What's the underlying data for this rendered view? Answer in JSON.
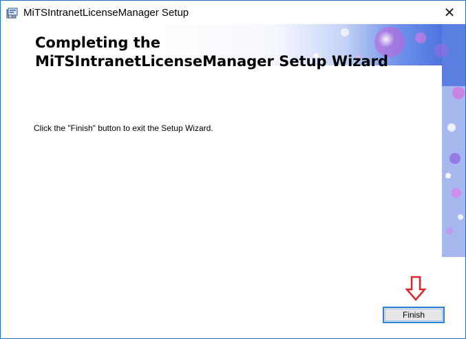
{
  "window": {
    "title": "MiTSIntranetLicenseManager Setup",
    "close_glyph": "✕",
    "icon": "installer-package-icon"
  },
  "wizard": {
    "heading_line1": "Completing the",
    "heading_line2": "MiTSIntranetLicenseManager Setup Wizard",
    "message": "Click the \"Finish\" button to exit the Setup Wizard."
  },
  "buttons": {
    "finish_label": "Finish"
  },
  "annotation": {
    "icon": "down-arrow-icon",
    "color": "#e0242a"
  },
  "colors": {
    "window_border": "#1c6fc4",
    "button_border": "#2b7fd6",
    "button_face": "#e6e6e6"
  }
}
